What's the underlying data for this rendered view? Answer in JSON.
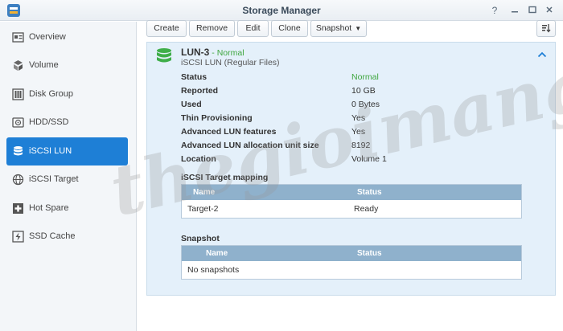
{
  "window": {
    "title": "Storage Manager",
    "icon": "storage-manager-icon",
    "controls": [
      "help-icon",
      "minimize-icon",
      "maximize-icon",
      "close-icon"
    ]
  },
  "sidebar": {
    "items": [
      {
        "label": "Overview",
        "icon": "overview-icon"
      },
      {
        "label": "Volume",
        "icon": "volume-icon"
      },
      {
        "label": "Disk Group",
        "icon": "disk-group-icon"
      },
      {
        "label": "HDD/SSD",
        "icon": "hdd-icon"
      },
      {
        "label": "iSCSI LUN",
        "icon": "iscsi-lun-icon",
        "active": true
      },
      {
        "label": "iSCSI Target",
        "icon": "iscsi-target-icon"
      },
      {
        "label": "Hot Spare",
        "icon": "hot-spare-icon"
      },
      {
        "label": "SSD Cache",
        "icon": "ssd-cache-icon"
      }
    ]
  },
  "toolbar": {
    "create": "Create",
    "remove": "Remove",
    "edit": "Edit",
    "clone": "Clone",
    "snapshot": "Snapshot"
  },
  "lun": {
    "name": "LUN-3",
    "status": "Normal",
    "type": "iSCSI LUN (Regular Files)",
    "properties": [
      {
        "label": "Status",
        "value": "Normal"
      },
      {
        "label": "Reported",
        "value": "10 GB"
      },
      {
        "label": "Used",
        "value": "0 Bytes"
      },
      {
        "label": "Thin Provisioning",
        "value": "Yes"
      },
      {
        "label": "Advanced LUN features",
        "value": "Yes"
      },
      {
        "label": "Advanced LUN allocation unit size",
        "value": "8192"
      },
      {
        "label": "Location",
        "value": "Volume 1"
      }
    ]
  },
  "target_mapping": {
    "title": "iSCSI Target mapping",
    "columns": [
      "Name",
      "Status"
    ],
    "rows": [
      {
        "name": "Target-2",
        "status": "Ready"
      }
    ]
  },
  "snapshot": {
    "title": "Snapshot",
    "columns": [
      "Name",
      "Status"
    ],
    "empty": "No snapshots"
  },
  "colors": {
    "accent": "#1e7fd6",
    "status_green": "#3fa63f",
    "panel_bg": "#e4f0fa",
    "grid_header": "#8fb1cc"
  },
  "watermark": "thegioimang.vn"
}
